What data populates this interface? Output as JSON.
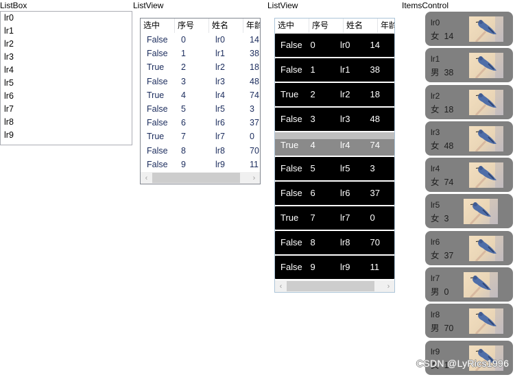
{
  "listbox": {
    "label": "ListBox",
    "items": [
      "lr0",
      "lr1",
      "lr2",
      "lr3",
      "lr4",
      "lr5",
      "lr6",
      "lr7",
      "lr8",
      "lr9"
    ]
  },
  "listview1": {
    "label": "ListView",
    "columns": [
      "选中",
      "序号",
      "姓名",
      "年龄"
    ],
    "rows": [
      [
        "False",
        "0",
        "lr0",
        "14"
      ],
      [
        "False",
        "1",
        "lr1",
        "38"
      ],
      [
        "True",
        "2",
        "lr2",
        "18"
      ],
      [
        "False",
        "3",
        "lr3",
        "48"
      ],
      [
        "True",
        "4",
        "lr4",
        "74"
      ],
      [
        "False",
        "5",
        "lr5",
        "3"
      ],
      [
        "False",
        "6",
        "lr6",
        "37"
      ],
      [
        "True",
        "7",
        "lr7",
        "0"
      ],
      [
        "False",
        "8",
        "lr8",
        "70"
      ],
      [
        "False",
        "9",
        "lr9",
        "11"
      ]
    ],
    "scroll_left": "‹",
    "scroll_right": "›"
  },
  "listview2": {
    "label": "ListView",
    "columns": [
      "选中",
      "序号",
      "姓名",
      "年龄"
    ],
    "rows": [
      [
        "False",
        "0",
        "lr0",
        "14"
      ],
      [
        "False",
        "1",
        "lr1",
        "38"
      ],
      [
        "True",
        "2",
        "lr2",
        "18"
      ],
      [
        "False",
        "3",
        "lr3",
        "48"
      ],
      [
        "True",
        "4",
        "lr4",
        "74"
      ],
      [
        "False",
        "5",
        "lr5",
        "3"
      ],
      [
        "False",
        "6",
        "lr6",
        "37"
      ],
      [
        "True",
        "7",
        "lr7",
        "0"
      ],
      [
        "False",
        "8",
        "lr8",
        "70"
      ],
      [
        "False",
        "9",
        "lr9",
        "11"
      ]
    ],
    "selected_index": 4,
    "scroll_left": "‹",
    "scroll_right": "›"
  },
  "itemscontrol": {
    "label": "ItemsControl",
    "items": [
      {
        "name": "lr0",
        "sex": "女",
        "age": "14",
        "icon": "bird-photo"
      },
      {
        "name": "lr1",
        "sex": "男",
        "age": "38",
        "icon": "bird-photo"
      },
      {
        "name": "lr2",
        "sex": "女",
        "age": "18",
        "icon": "bird-photo"
      },
      {
        "name": "lr3",
        "sex": "女",
        "age": "48",
        "icon": "bird-photo"
      },
      {
        "name": "lr4",
        "sex": "女",
        "age": "74",
        "icon": "bird-photo"
      },
      {
        "name": "lr5",
        "sex": "女",
        "age": "3",
        "icon": "bird-photo"
      },
      {
        "name": "lr6",
        "sex": "女",
        "age": "37",
        "icon": "bird-photo"
      },
      {
        "name": "lr7",
        "sex": "男",
        "age": "0",
        "icon": "bird-photo"
      },
      {
        "name": "lr8",
        "sex": "男",
        "age": "70",
        "icon": "bird-photo"
      },
      {
        "name": "lr9",
        "sex": "女",
        "age": "11",
        "icon": "bird-photo"
      }
    ]
  },
  "watermark": "CSDN @LyRics1996",
  "colors": {
    "card_bg": "#808080",
    "row_bg_dark": "#000000",
    "row_selected": "#8a8a8a",
    "listview_text": "#1a2b5c"
  }
}
